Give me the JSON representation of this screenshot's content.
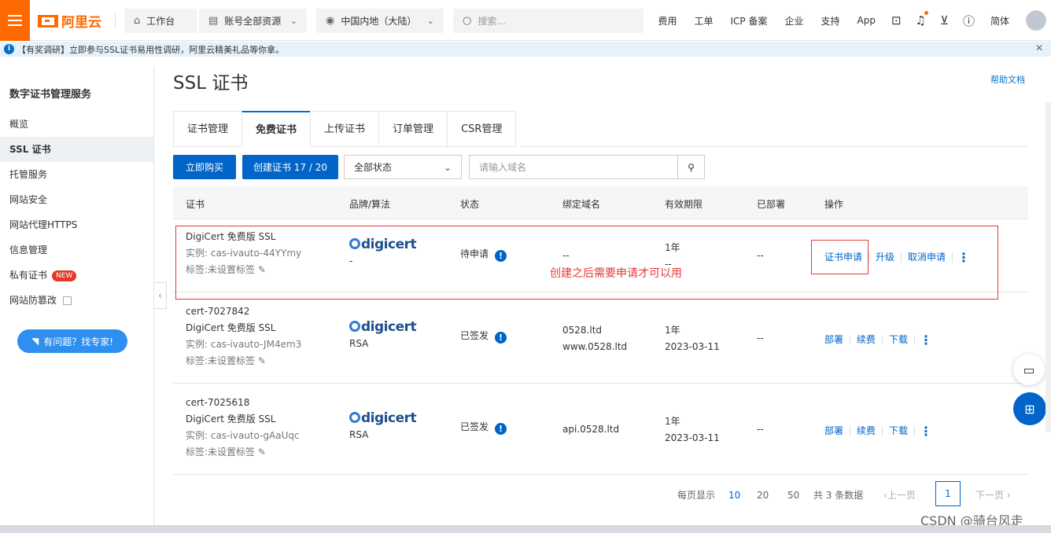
{
  "topbar": {
    "logo": "阿里云",
    "workbench": "工作台",
    "resources": "账号全部资源",
    "region": "中国内地（大陆）",
    "search_placeholder": "搜索...",
    "links": [
      "费用",
      "工单",
      "ICP 备案",
      "企业",
      "支持",
      "App"
    ],
    "lang": "简体"
  },
  "notice": {
    "text": "【有奖调研】立即参与SSL证书易用性调研，阿里云精美礼品等你拿。"
  },
  "sidebar": {
    "title": "数字证书管理服务",
    "items": [
      "概览",
      "SSL 证书",
      "托管服务",
      "网站安全",
      "网站代理HTTPS",
      "信息管理",
      "私有证书",
      "网站防篡改"
    ],
    "new_badge": "NEW",
    "expert_button": "有问题？找专家!"
  },
  "page": {
    "title": "SSL 证书",
    "help": "帮助文档",
    "tabs": [
      "证书管理",
      "免费证书",
      "上传证书",
      "订单管理",
      "CSR管理"
    ],
    "buy_button": "立即购买",
    "create_button": "创建证书 17 / 20",
    "status_select": "全部状态",
    "domain_placeholder": "请输入域名"
  },
  "table": {
    "headers": [
      "证书",
      "品牌/算法",
      "状态",
      "绑定域名",
      "有效期限",
      "已部署",
      "操作"
    ],
    "rows": [
      {
        "name": "",
        "product": "DigiCert 免费版 SSL",
        "instance": "实例: cas-ivauto-44YYmy",
        "tag": "标签:未设置标签",
        "brand": "digicert",
        "algo": "-",
        "status": "待申请",
        "domain1": "--",
        "domain2": "",
        "validity": "1年",
        "expiry": "--",
        "deployed": "--",
        "ops": [
          "证书申请",
          "升级",
          "取消申请"
        ]
      },
      {
        "name": "cert-7027842",
        "product": "DigiCert 免费版 SSL",
        "instance": "实例: cas-ivauto-JM4em3",
        "tag": "标签:未设置标签",
        "brand": "digicert",
        "algo": "RSA",
        "status": "已签发",
        "domain1": "0528.ltd",
        "domain2": "www.0528.ltd",
        "validity": "1年",
        "expiry": "2023-03-11",
        "deployed": "--",
        "ops": [
          "部署",
          "续费",
          "下载"
        ]
      },
      {
        "name": "cert-7025618",
        "product": "DigiCert 免费版 SSL",
        "instance": "实例: cas-ivauto-gAaUqc",
        "tag": "标签:未设置标签",
        "brand": "digicert",
        "algo": "RSA",
        "status": "已签发",
        "domain1": "api.0528.ltd",
        "domain2": "",
        "validity": "1年",
        "expiry": "2023-03-11",
        "deployed": "--",
        "ops": [
          "部署",
          "续费",
          "下载"
        ]
      }
    ]
  },
  "annotation": "创建之后需要申请才可以用",
  "pagination": {
    "per_page_label": "每页显示",
    "sizes": [
      "10",
      "20",
      "50"
    ],
    "total": "共 3 条数据",
    "prev": "上一页",
    "current": "1",
    "next": "下一页"
  },
  "watermark": "CSDN @骑台风走",
  "colors": {
    "brand": "#ff6a00",
    "primary": "#0064c8",
    "annotation": "#e53935"
  }
}
